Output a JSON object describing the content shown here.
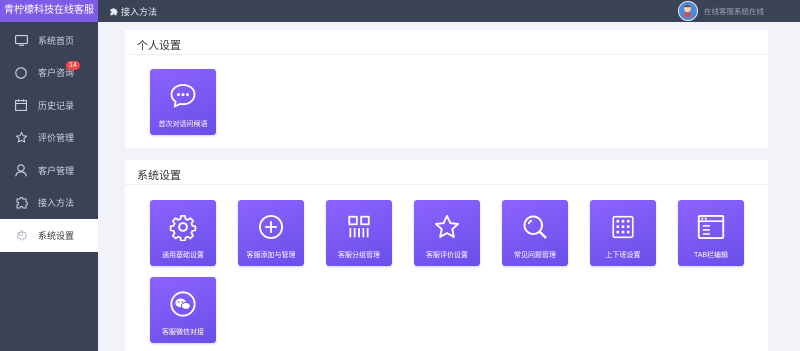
{
  "brand": "青柠檬科技在线客服",
  "header": {
    "title": "接入方法",
    "status": "在线客服系统在线"
  },
  "sidebar": {
    "items": [
      {
        "label": "系统首页",
        "icon": "monitor-icon"
      },
      {
        "label": "客户咨询",
        "icon": "chat-circle-icon",
        "badge": "14"
      },
      {
        "label": "历史记录",
        "icon": "calendar-icon"
      },
      {
        "label": "评价管理",
        "icon": "star-icon"
      },
      {
        "label": "客户管理",
        "icon": "user-icon"
      },
      {
        "label": "接入方法",
        "icon": "puzzle-icon"
      },
      {
        "label": "系统设置",
        "icon": "gear-icon",
        "active": true
      }
    ]
  },
  "personal": {
    "title": "个人设置",
    "tiles": [
      {
        "label": "首次对话问候语",
        "icon": "chat-bubble-icon"
      }
    ]
  },
  "system": {
    "title": "系统设置",
    "tiles": [
      {
        "label": "通用基础设置",
        "icon": "gear-icon"
      },
      {
        "label": "客服添加与管理",
        "icon": "plus-circle-icon"
      },
      {
        "label": "客服分组管理",
        "icon": "group-grid-icon"
      },
      {
        "label": "客服评价设置",
        "icon": "star-icon"
      },
      {
        "label": "常见问题管理",
        "icon": "search-icon"
      },
      {
        "label": "上下班设置",
        "icon": "dots-grid-icon"
      },
      {
        "label": "TAB栏编辑",
        "icon": "window-icon"
      },
      {
        "label": "客服微信对接",
        "icon": "wechat-icon"
      }
    ]
  },
  "colors": {
    "accent": "#7f5ce8",
    "sidebar_bg": "#3a4356",
    "badge": "#f2474b"
  }
}
